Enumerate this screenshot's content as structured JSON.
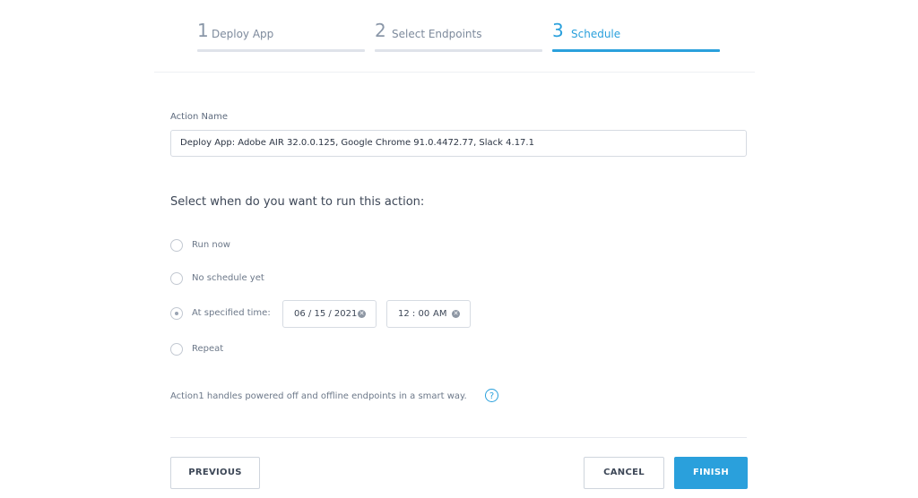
{
  "wizard": {
    "steps": [
      {
        "number": "1",
        "label": "Deploy App"
      },
      {
        "number": "2",
        "label": "Select Endpoints"
      },
      {
        "number": "3",
        "label": "Schedule"
      }
    ],
    "active_step": 3
  },
  "form": {
    "action_name_label": "Action Name",
    "action_name_value": "Deploy App: Adobe AIR 32.0.0.125, Google Chrome 91.0.4472.77, Slack 4.17.1",
    "schedule_heading": "Select when do you want to run this action:",
    "options": [
      {
        "label": "Run now",
        "selected": false
      },
      {
        "label": "No schedule yet",
        "selected": false
      },
      {
        "label": "At specified time:",
        "selected": true
      },
      {
        "label": "Repeat",
        "selected": false
      }
    ],
    "date_value": "06 / 15 / 2021",
    "time_value": "12 : 00",
    "time_period": "AM",
    "info_text": "Action1 handles powered off and offline endpoints in a smart way."
  },
  "footer": {
    "previous_label": "PREVIOUS",
    "cancel_label": "CANCEL",
    "finish_label": "FINISH"
  },
  "colors": {
    "accent": "#2aa0dc",
    "inactive_step": "#8a97a8"
  }
}
